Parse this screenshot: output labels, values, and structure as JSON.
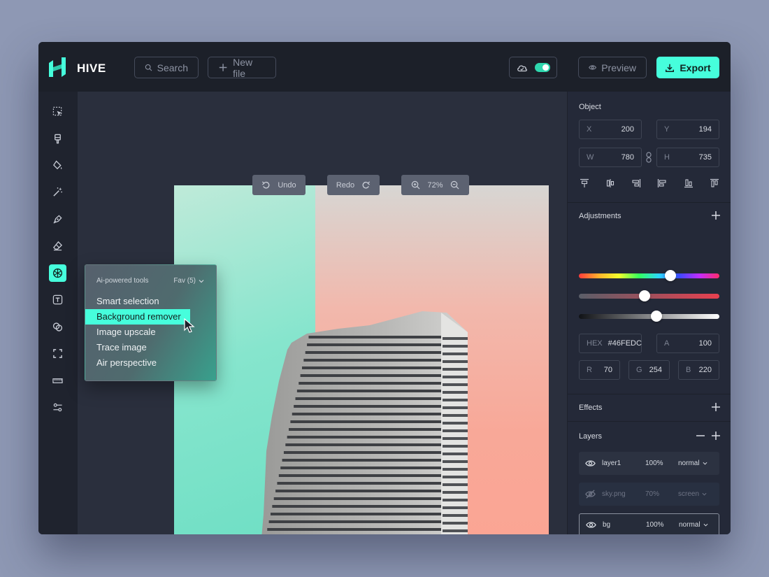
{
  "header": {
    "brand": "HIVE",
    "search_label": "Search",
    "new_file_label": "New file",
    "preview_label": "Preview",
    "export_label": "Export"
  },
  "canvas": {
    "undo_label": "Undo",
    "redo_label": "Redo",
    "zoom": "72%"
  },
  "ai_popup": {
    "title": "Ai-powered tools",
    "fav": "Fav (5)",
    "items": [
      "Smart selection",
      "Background remover",
      "Image upscale",
      "Trace image",
      "Air perspective"
    ],
    "selected_index": 1
  },
  "object": {
    "title": "Object",
    "x": {
      "label": "X",
      "value": "200"
    },
    "y": {
      "label": "Y",
      "value": "194"
    },
    "w": {
      "label": "W",
      "value": "780"
    },
    "h": {
      "label": "H",
      "value": "735"
    }
  },
  "adjustments": {
    "title": "Adjustments",
    "hue_level": 0.65,
    "saturation_level": 0.47,
    "lightness_level": 0.55,
    "hex": {
      "label": "HEX",
      "value": "#46FEDC"
    },
    "alpha": {
      "label": "A",
      "value": "100"
    },
    "r": {
      "label": "R",
      "value": "70"
    },
    "g": {
      "label": "G",
      "value": "254"
    },
    "b": {
      "label": "B",
      "value": "220"
    }
  },
  "effects": {
    "title": "Effects"
  },
  "layers": {
    "title": "Layers",
    "items": [
      {
        "name": "layer1",
        "opacity": "100%",
        "mode": "normal"
      },
      {
        "name": "sky.png",
        "opacity": "70%",
        "mode": "screen"
      },
      {
        "name": "bg",
        "opacity": "100%",
        "mode": "normal"
      }
    ]
  },
  "colors": {
    "accent": "#46FEDC",
    "app_bg": "#262B39",
    "header_bg": "#1C2029",
    "page_bg": "#8E98B4"
  }
}
